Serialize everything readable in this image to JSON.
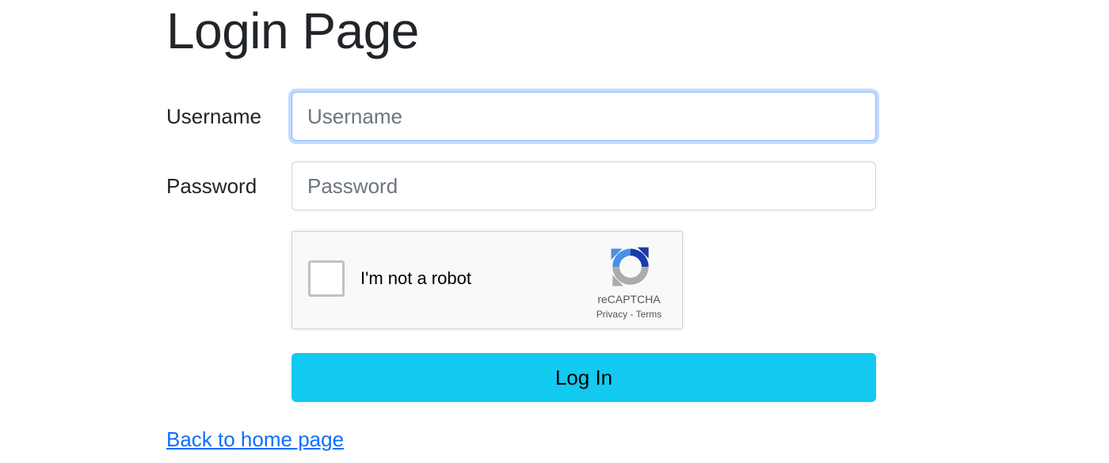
{
  "page": {
    "title": "Login Page"
  },
  "form": {
    "username_label": "Username",
    "username_placeholder": "Username",
    "username_value": "",
    "password_label": "Password",
    "password_placeholder": "Password",
    "password_value": "",
    "username_focused": true
  },
  "recaptcha": {
    "checkbox_label": "I'm not a robot",
    "checked": false,
    "brand": "reCAPTCHA",
    "privacy_label": "Privacy",
    "separator": " - ",
    "terms_label": "Terms",
    "icon": "recaptcha-logo-icon"
  },
  "actions": {
    "login_label": "Log In",
    "back_link_label": "Back to home page"
  },
  "colors": {
    "primary_link": "#0d6efd",
    "button_bg": "#13caf0",
    "focus_ring": "#86b7fe",
    "text": "#212529"
  }
}
